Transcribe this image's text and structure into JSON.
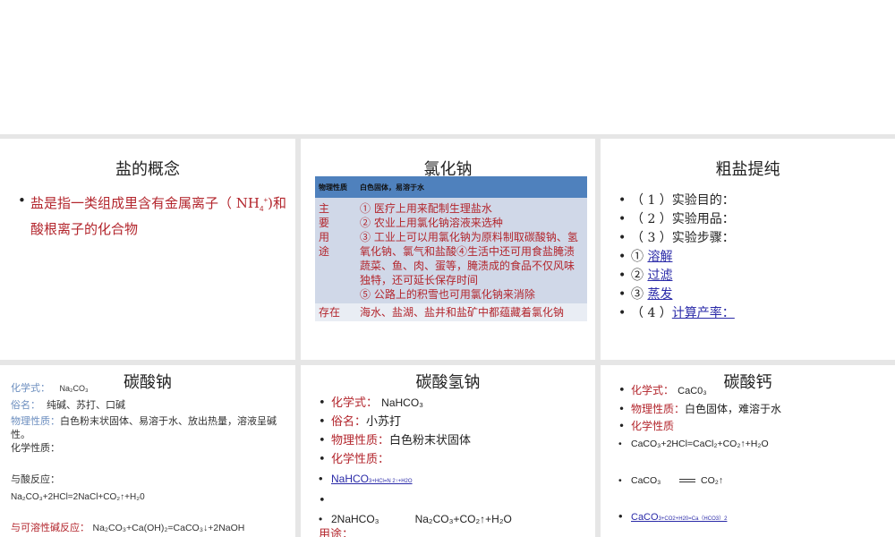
{
  "s1": {
    "title": "盐的概念",
    "text": "盐是指一类组成里含有金属离子（ NH",
    "sub": "4",
    "sup": "+",
    "text2": ")和酸根离子的化合物"
  },
  "s2": {
    "title": "氯化钠",
    "hdr_label": "物理性质",
    "hdr_value": "白色固体，易溶于水",
    "use_label": "主要用途",
    "uses": [
      "① 医疗上用来配制生理盐水",
      "② 农业上用氯化钠溶液来选种",
      "③ 工业上可以用氯化钠为原料制取碳酸钠、氢氧化钠、氯气和盐酸④生活中还可用食盐腌渍蔬菜、鱼、肉、蛋等，腌渍成的食品不仅风味独特，还可延长保存时间",
      "⑤ 公路上的积雪也可用氯化钠来消除"
    ],
    "exist_label": "存在",
    "exist_value": "海水、盐湖、盐井和盐矿中都蕴藏着氯化钠"
  },
  "s3": {
    "title": "粗盐提纯",
    "items": [
      "（ 1 ）实验目的：",
      "（ 2 ）实验用品：",
      "（ 3 ）实验步骤："
    ],
    "steps": [
      {
        "num": "①",
        "link": "溶解"
      },
      {
        "num": "②",
        "link": "过滤"
      },
      {
        "num": "③",
        "link": "蒸发"
      },
      {
        "num": "（ 4 ）",
        "link": "计算产率："
      }
    ]
  },
  "s4": {
    "title": "碳酸钠",
    "formula_label": "化学式：",
    "formula": "Na₂CO₃",
    "name_label": "俗名：",
    "name": "纯碱、苏打、口碱",
    "phys_label": "物理性质：",
    "phys": "白色粉末状固体、易溶于水、放出热量，溶液呈碱性。",
    "chem_label": "化学性质：",
    "acid_label": "与酸反应：",
    "acid_eq": "Na₂CO₃+2HCl=2NaCl+CO₂↑+H₂0",
    "base_label": "与可溶性碱反应：",
    "base_eq": "Na₂CO₃+Ca(OH)₂=CaCO₃↓+2NaOH"
  },
  "s5": {
    "title": "碳酸氢钠",
    "formula_label": "化学式：",
    "formula": "NaHCO₃",
    "name_label": "俗名：",
    "name": "小苏打",
    "phys_label": "物理性质：",
    "phys": "白色粉末状固体",
    "chem_label": "化学性质：",
    "link1": "NaHCO",
    "link1_tail": "3+HCl=N      2↑+H2O",
    "eq": "2NaHCO₃",
    "eq_right": "Na₂CO₃+CO₂↑+H₂O",
    "use_label": "用途："
  },
  "s6": {
    "title": "碳酸钙",
    "formula_label": "化学式：",
    "formula": "CaC0₃",
    "phys_label": "物理性质：",
    "phys": "白色固体，难溶于水",
    "chem_label": "化学性质",
    "eq1": "CaCO₃+2HCl=CaCl₂+CO₂↑+H₂O",
    "eq2_left": "CaCO₃",
    "eq2_right": "CO₂↑",
    "link": "CaCO",
    "link_tail": "3+CO2+H20=Ca（HCO3）2"
  }
}
